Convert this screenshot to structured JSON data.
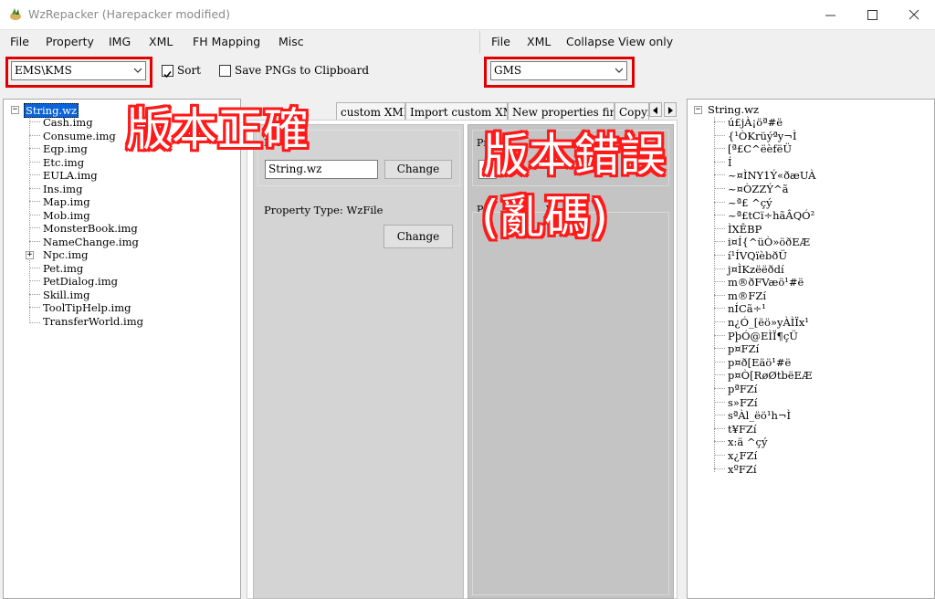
{
  "window": {
    "title": "WzRepacker (Harepacker modified)"
  },
  "menu_left": [
    "File",
    "Property",
    "IMG",
    "XML",
    "FH Mapping",
    "Misc"
  ],
  "menu_right": [
    "File",
    "XML",
    "Collapse View only"
  ],
  "toolbar": {
    "left_version": "EMS\\KMS",
    "sort_label": "Sort",
    "sort_checked": true,
    "save_png_label": "Save PNGs to Clipboard",
    "save_png_checked": false,
    "right_version": "GMS"
  },
  "left_tree": {
    "root": "String.wz",
    "items": [
      "Cash.img",
      "Consume.img",
      "Eqp.img",
      "Etc.img",
      "EULA.img",
      "Ins.img",
      "Map.img",
      "Mob.img",
      "MonsterBook.img",
      "NameChange.img",
      "Npc.img",
      "Pet.img",
      "PetDialog.img",
      "Skill.img",
      "ToolTipHelp.img",
      "TransferWorld.img"
    ]
  },
  "tabs": [
    "custom XML",
    "Import custom XML",
    "New properties finder",
    "Copyi"
  ],
  "center": {
    "group_left_label": "Prope",
    "name_value": "String.wz",
    "change_label": "Change",
    "property_type": "Property Type: WzFile",
    "change2_label": "Change",
    "group_right_label": "Pr",
    "group_right_label2": "P",
    "group_right_label3": "W"
  },
  "right_tree": {
    "root": "String.wz",
    "items": [
      "ú£jÀ¡öª#ë",
      "{¹ÒKrüýªy¬Ì",
      "[ª£C^ëèfëÜ",
      "Í",
      "~¤ÌNY1Ý«ðæUÀ",
      "~¤ÒZZÝ^ã",
      "~ª£  ^çý",
      "~ª£tCï÷hãÂQÓ²",
      "ÌXÊBP",
      "i¤Í{^üÒ»öðEÆ",
      "í¹ÍVQïèbðÜ",
      "j¤ÌKzëëðdí",
      "m®ðFVæö¹#ë",
      "m®FZí",
      "nÍCã÷¹",
      "n¿Ó_[ëö»yÀÌÏx¹",
      "PþÓ@EÌÏ¶çÜ",
      "p¤FZí",
      "p¤ð[Eäö¹#ë",
      "p¤Ò[RøØtbëEÆ",
      "pªFZí",
      "s»FZí",
      "sªÀl_ëö¹h¬Ì",
      "t¥FZí",
      "x:ä    ^çý",
      "x¿FZí",
      "xºFZí"
    ]
  },
  "annotations": {
    "correct": "版本正確",
    "wrong": "版本錯誤",
    "garbled": "(亂碼)"
  },
  "colors": {
    "highlight_red": "#e00000",
    "selection_blue": "#0a64d8"
  }
}
